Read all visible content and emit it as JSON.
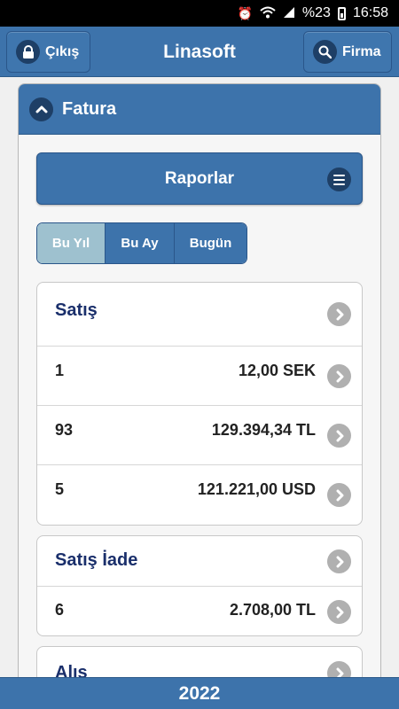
{
  "status_bar": {
    "battery": "%23",
    "time": "16:58"
  },
  "header": {
    "logout_label": "Çıkış",
    "title": "Linasoft",
    "firm_label": "Firma"
  },
  "panel": {
    "title": "Fatura"
  },
  "reports": {
    "label": "Raporlar"
  },
  "period_tabs": [
    {
      "label": "Bu Yıl",
      "active": true
    },
    {
      "label": "Bu Ay",
      "active": false
    },
    {
      "label": "Bugün",
      "active": false
    }
  ],
  "sales": {
    "title": "Satış",
    "rows": [
      {
        "count": "1",
        "amount": "12,00 SEK"
      },
      {
        "count": "93",
        "amount": "129.394,34 TL"
      },
      {
        "count": "5",
        "amount": "121.221,00 USD"
      }
    ]
  },
  "sales_return": {
    "title": "Satış İade",
    "rows": [
      {
        "count": "6",
        "amount": "2.708,00 TL"
      }
    ]
  },
  "purchases": {
    "title": "Alış"
  },
  "footer": {
    "year": "2022"
  }
}
